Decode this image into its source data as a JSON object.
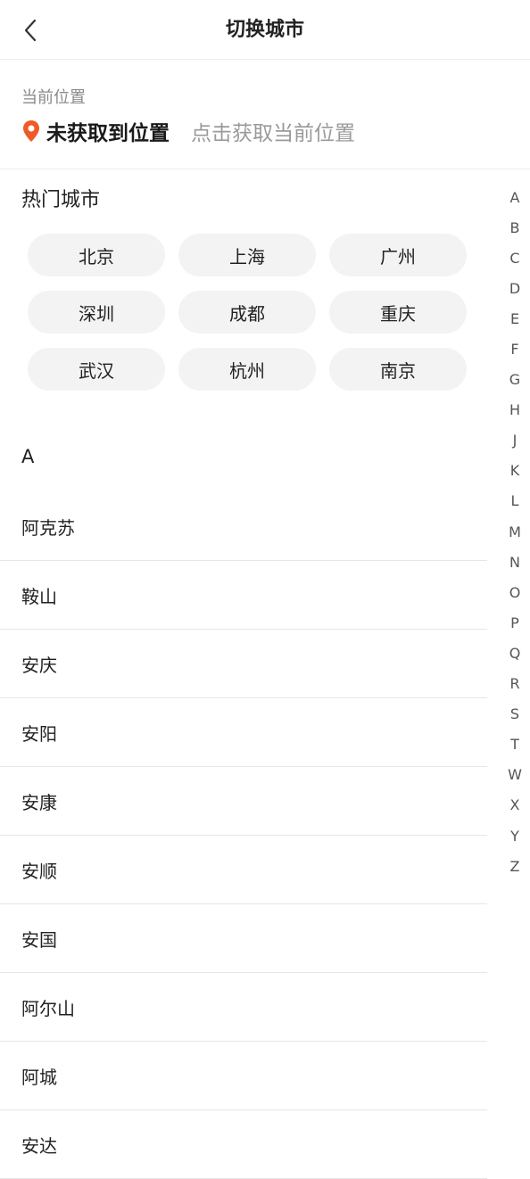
{
  "header": {
    "title": "切换城市",
    "back_icon": "chevron-left-icon"
  },
  "location": {
    "label": "当前位置",
    "status": "未获取到位置",
    "action": "点击获取当前位置",
    "pin_color": "#f05a28",
    "pin_icon": "location-pin-icon"
  },
  "hot_cities": {
    "title": "热门城市",
    "items": [
      "北京",
      "上海",
      "广州",
      "深圳",
      "成都",
      "重庆",
      "武汉",
      "杭州",
      "南京"
    ]
  },
  "city_section": {
    "letter": "A",
    "cities": [
      "阿克苏",
      "鞍山",
      "安庆",
      "安阳",
      "安康",
      "安顺",
      "安国",
      "阿尔山",
      "阿城",
      "安达"
    ]
  },
  "alphabet_index": [
    "A",
    "B",
    "C",
    "D",
    "E",
    "F",
    "G",
    "H",
    "J",
    "K",
    "L",
    "M",
    "N",
    "O",
    "P",
    "Q",
    "R",
    "S",
    "T",
    "W",
    "X",
    "Y",
    "Z"
  ]
}
